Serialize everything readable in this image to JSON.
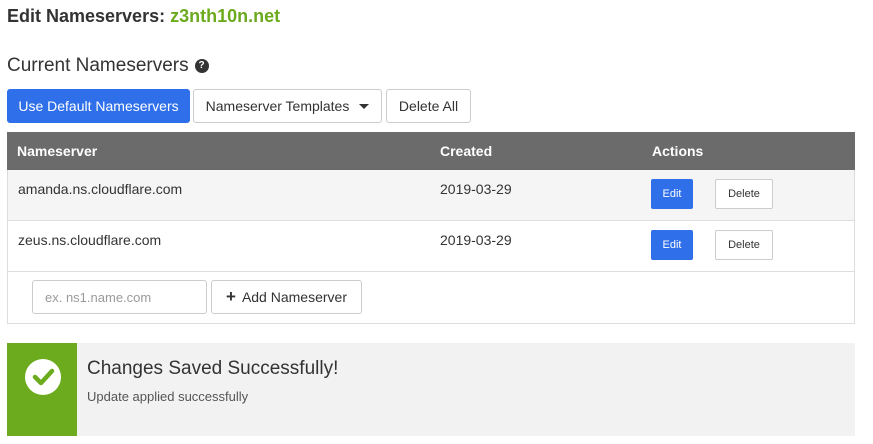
{
  "header": {
    "title_prefix": "Edit Nameservers:",
    "domain": "z3nth10n.net"
  },
  "section": {
    "title": "Current Nameservers",
    "help_glyph": "?"
  },
  "toolbar": {
    "default_label": "Use Default Nameservers",
    "templates_label": "Nameserver Templates",
    "delete_all_label": "Delete All"
  },
  "table": {
    "columns": [
      "Nameserver",
      "Created",
      "Actions"
    ],
    "rows": [
      {
        "nameserver": "amanda.ns.cloudflare.com",
        "created": "2019-03-29",
        "edit": "Edit",
        "delete": "Delete"
      },
      {
        "nameserver": "zeus.ns.cloudflare.com",
        "created": "2019-03-29",
        "edit": "Edit",
        "delete": "Delete"
      }
    ]
  },
  "add": {
    "placeholder": "ex. ns1.name.com",
    "value": "",
    "button_label": "Add Nameserver"
  },
  "alert": {
    "title": "Changes Saved Successfully!",
    "message": "Update applied successfully",
    "icon": "check-circle-icon"
  },
  "colors": {
    "accent_green": "#6cab1e",
    "primary_blue": "#2f6fea",
    "table_header": "#6b6b6b"
  }
}
